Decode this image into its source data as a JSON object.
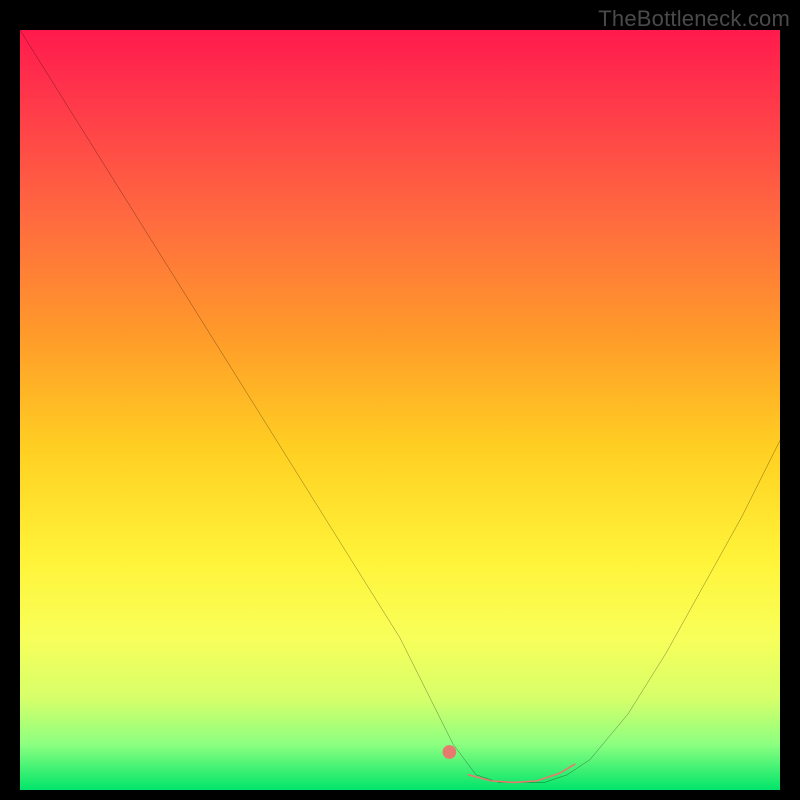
{
  "watermark": "TheBottleneck.com",
  "chart_data": {
    "type": "line",
    "title": "",
    "xlabel": "",
    "ylabel": "",
    "xlim": [
      0,
      100
    ],
    "ylim": [
      0,
      100
    ],
    "grid": false,
    "series": [
      {
        "name": "curve",
        "color": "#000000",
        "x": [
          0,
          5,
          10,
          15,
          20,
          25,
          30,
          35,
          40,
          45,
          50,
          54,
          57,
          60,
          63,
          66,
          69,
          72,
          75,
          80,
          85,
          90,
          95,
          100
        ],
        "values": [
          100,
          92,
          84,
          76,
          68,
          60,
          52,
          44,
          36,
          28,
          20,
          12,
          6,
          2,
          1,
          1,
          1,
          2,
          4,
          10,
          18,
          27,
          36,
          46
        ]
      },
      {
        "name": "highlight-dot",
        "color": "#e77a6f",
        "x": [
          56.5
        ],
        "values": [
          5
        ]
      },
      {
        "name": "highlight-segment",
        "color": "#e77a6f",
        "x": [
          59,
          62,
          65,
          68,
          71,
          73
        ],
        "values": [
          2,
          1.2,
          1.0,
          1.2,
          2.2,
          3.4
        ]
      }
    ],
    "background_gradient": {
      "direction": "vertical",
      "stops": [
        {
          "pos": 0.0,
          "color": "#ff1a4d"
        },
        {
          "pos": 0.25,
          "color": "#ff6b3f"
        },
        {
          "pos": 0.55,
          "color": "#ffcf22"
        },
        {
          "pos": 0.8,
          "color": "#f8ff5a"
        },
        {
          "pos": 1.0,
          "color": "#00e56a"
        }
      ]
    }
  }
}
